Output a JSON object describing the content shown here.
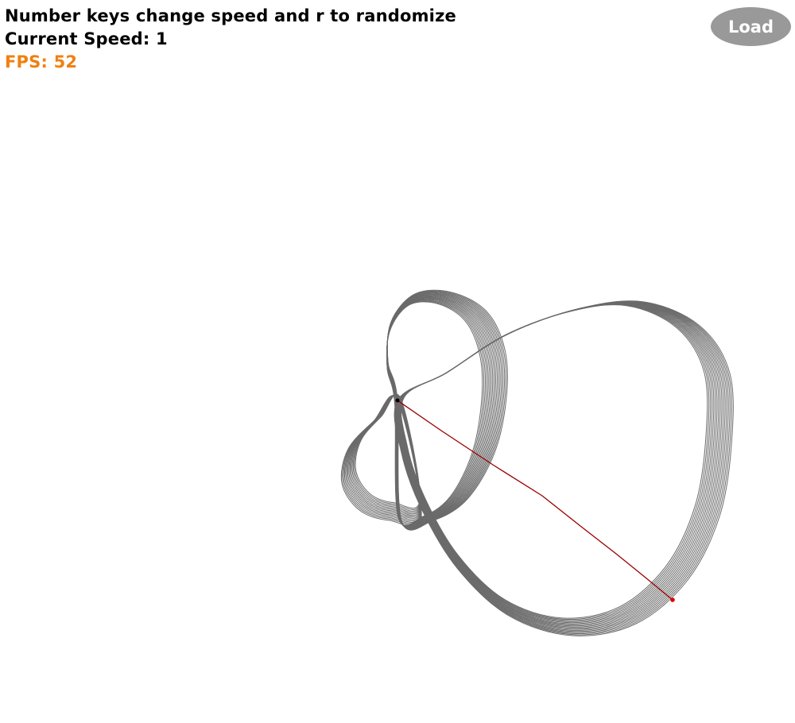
{
  "hud": {
    "instructions": "Number keys change speed and r to randomize",
    "speed_text": "Current Speed: 1",
    "fps_text": "FPS: 52"
  },
  "load_button": {
    "label": "Load"
  },
  "colors": {
    "hud_text": "#000000",
    "fps_text": "#f08010",
    "button_bg": "#999999",
    "button_text": "#ffffff",
    "curve_stroke": "#6a6a6a",
    "path_stroke": "#990000",
    "pivot_point": "#000000",
    "end_point": "#e00000"
  }
}
